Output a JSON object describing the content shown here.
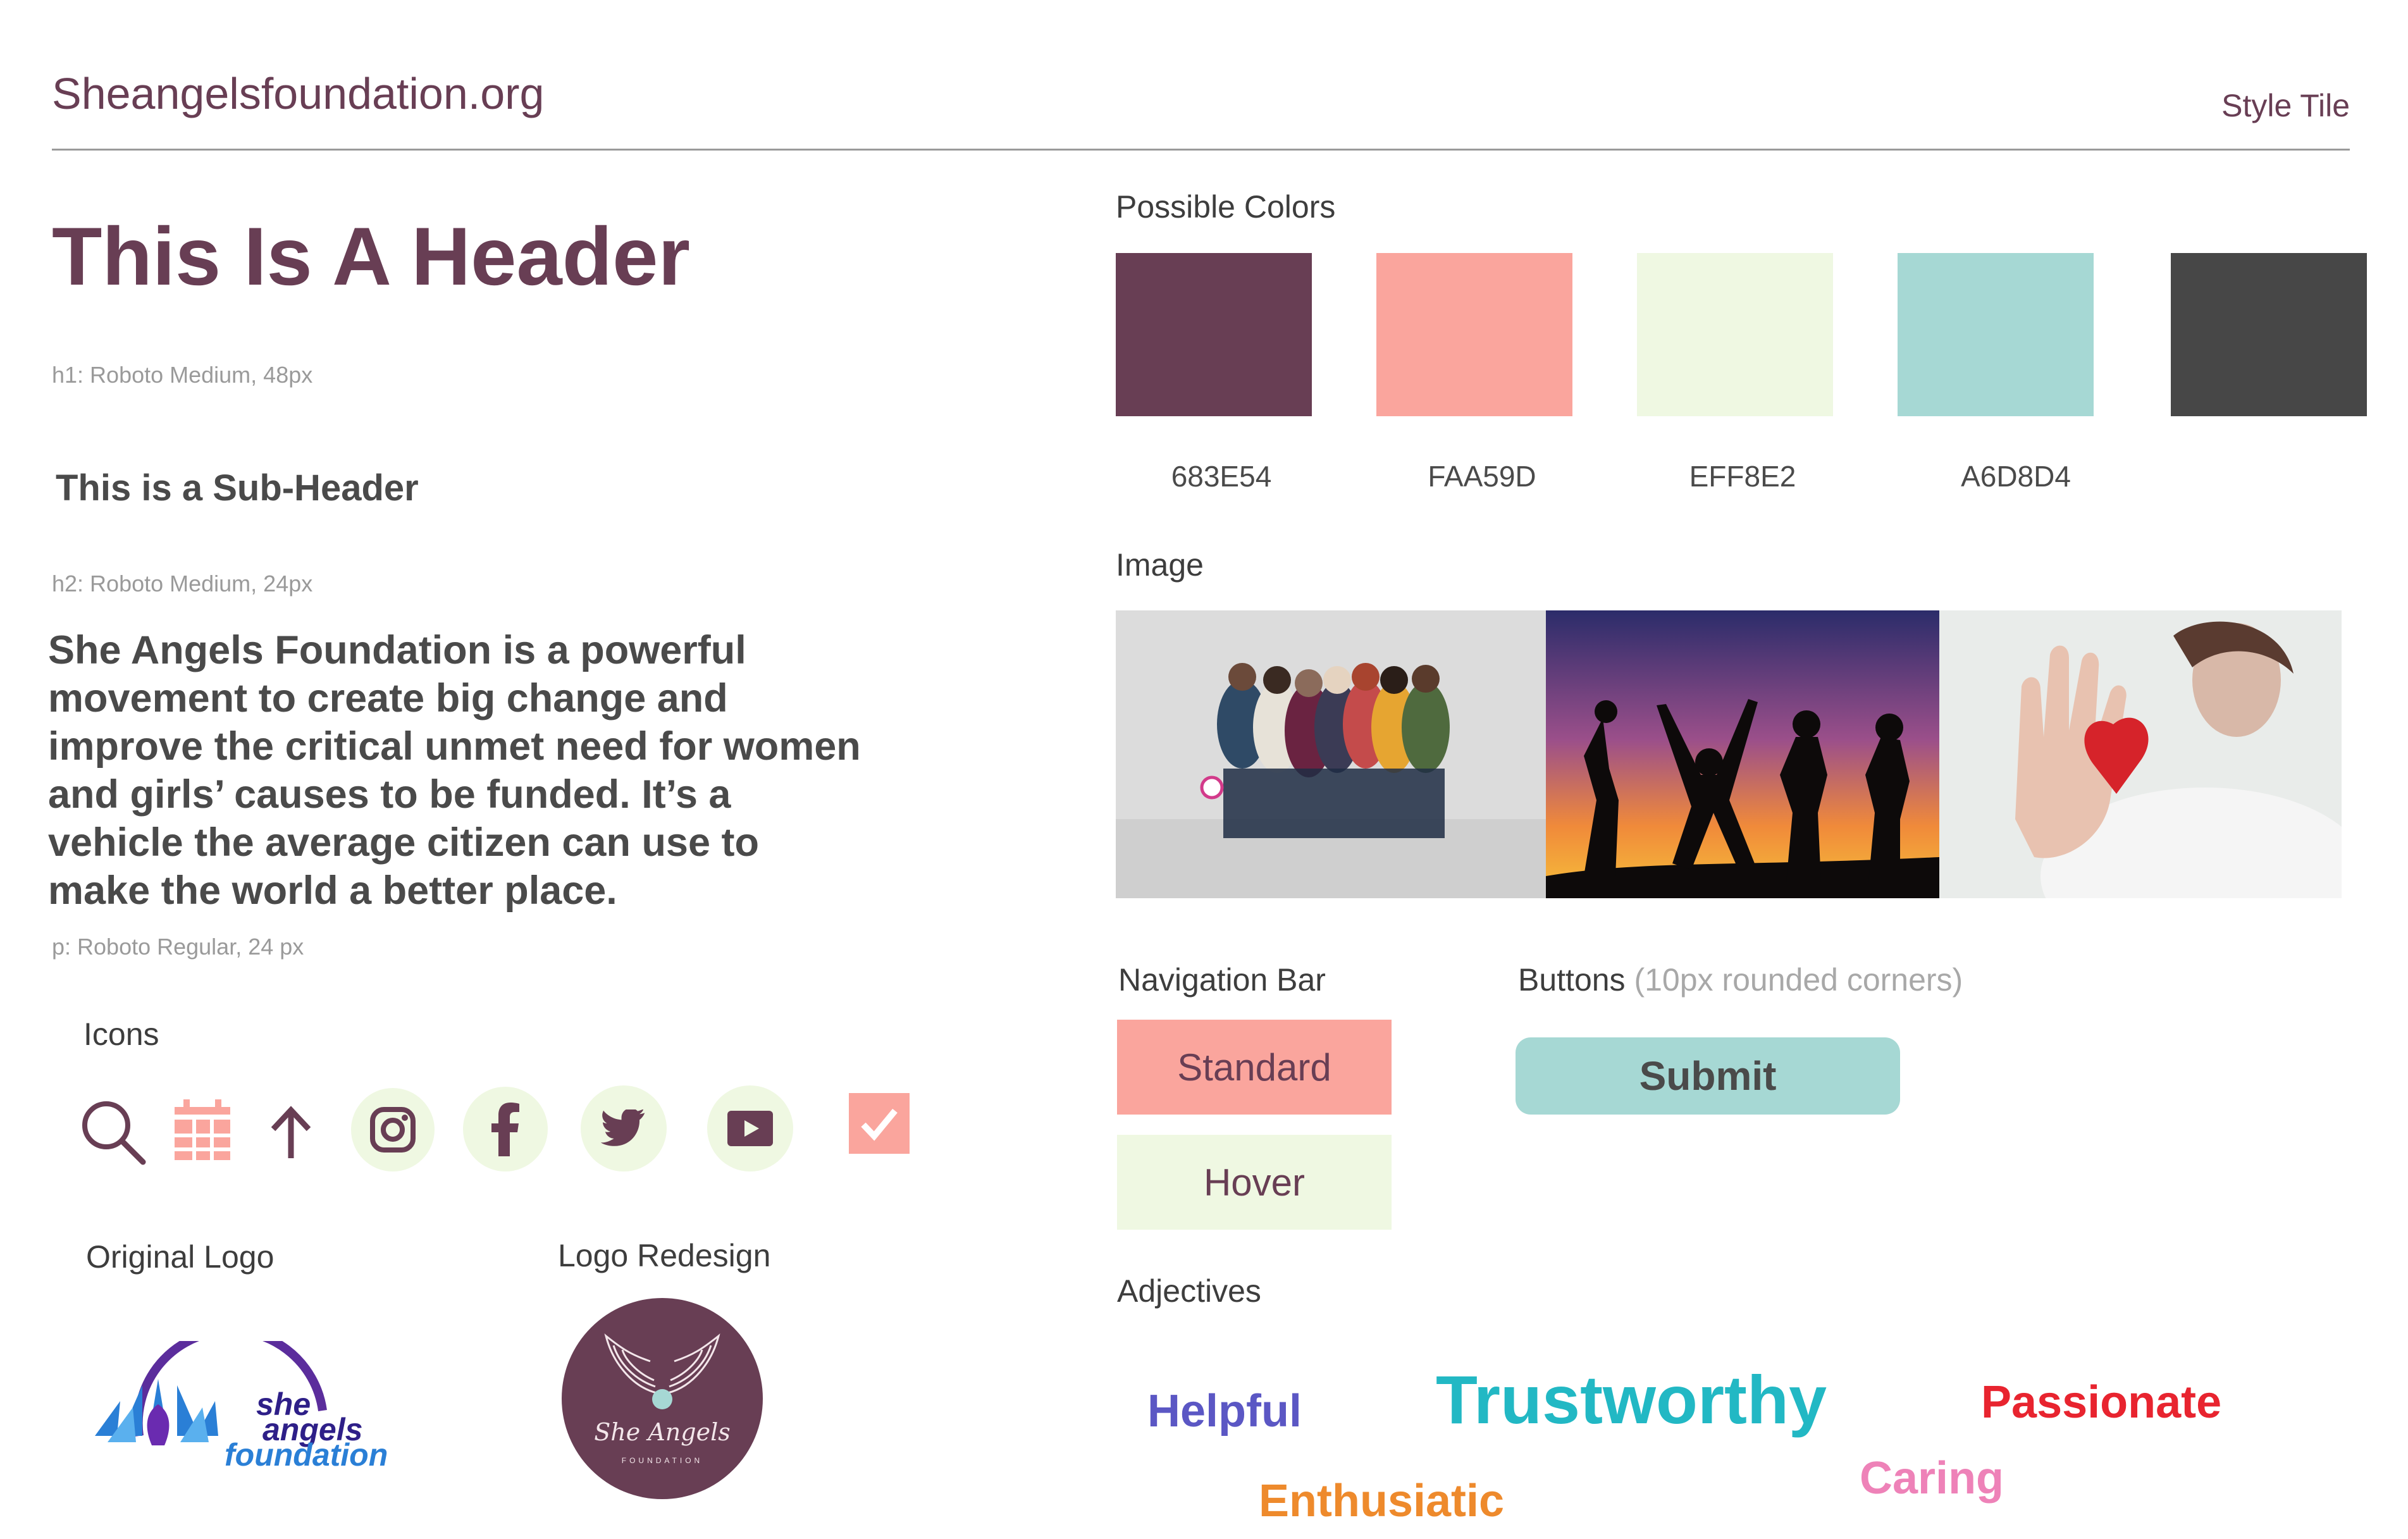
{
  "header": {
    "site_title": "Sheangelsfoundation.org",
    "style_tile": "Style Tile"
  },
  "typography": {
    "h1_text": "This Is A Header",
    "h1_note": "h1: Roboto Medium, 48px",
    "h2_text": "This is a Sub-Header",
    "h2_note": "h2: Roboto Medium, 24px",
    "paragraph": "She Angels Foundation is a powerful movement to create big change and improve the critical unmet need for women and girls’ causes to be funded. It’s a vehicle the average citizen can use to make the world a better place.",
    "p_note": "p: Roboto Regular, 24 px"
  },
  "icons": {
    "label": "Icons",
    "items": [
      "search-icon",
      "calendar-icon",
      "arrow-up-icon",
      "instagram-icon",
      "facebook-icon",
      "twitter-icon",
      "youtube-icon",
      "checkbox-icon"
    ]
  },
  "logos": {
    "original_label": "Original Logo",
    "redesign_label": "Logo Redesign",
    "original_text": {
      "line1": "she",
      "line2": "angels",
      "line3": "foundation"
    },
    "redesign_text": {
      "script": "She Angels",
      "small": "FOUNDATION"
    }
  },
  "colors": {
    "label": "Possible Colors",
    "swatches": [
      {
        "hex": "683E54",
        "color": "#683E54"
      },
      {
        "hex": "FAA59D",
        "color": "#FAA59D"
      },
      {
        "hex": "EFF8E2",
        "color": "#EFF8E2"
      },
      {
        "hex": "A6D8D4",
        "color": "#A6D8D4"
      },
      {
        "hex": "",
        "color": "#474747"
      }
    ]
  },
  "image_section": {
    "label": "Image"
  },
  "navigation": {
    "label": "Navigation Bar",
    "standard": "Standard",
    "hover": "Hover"
  },
  "buttons": {
    "label": "Buttons",
    "note": "(10px rounded corners)",
    "submit": "Submit"
  },
  "adjectives": {
    "label": "Adjectives",
    "helpful": "Helpful",
    "trustworthy": "Trustworthy",
    "passionate": "Passionate",
    "caring": "Caring",
    "enthusiatic": "Enthusiatic"
  }
}
